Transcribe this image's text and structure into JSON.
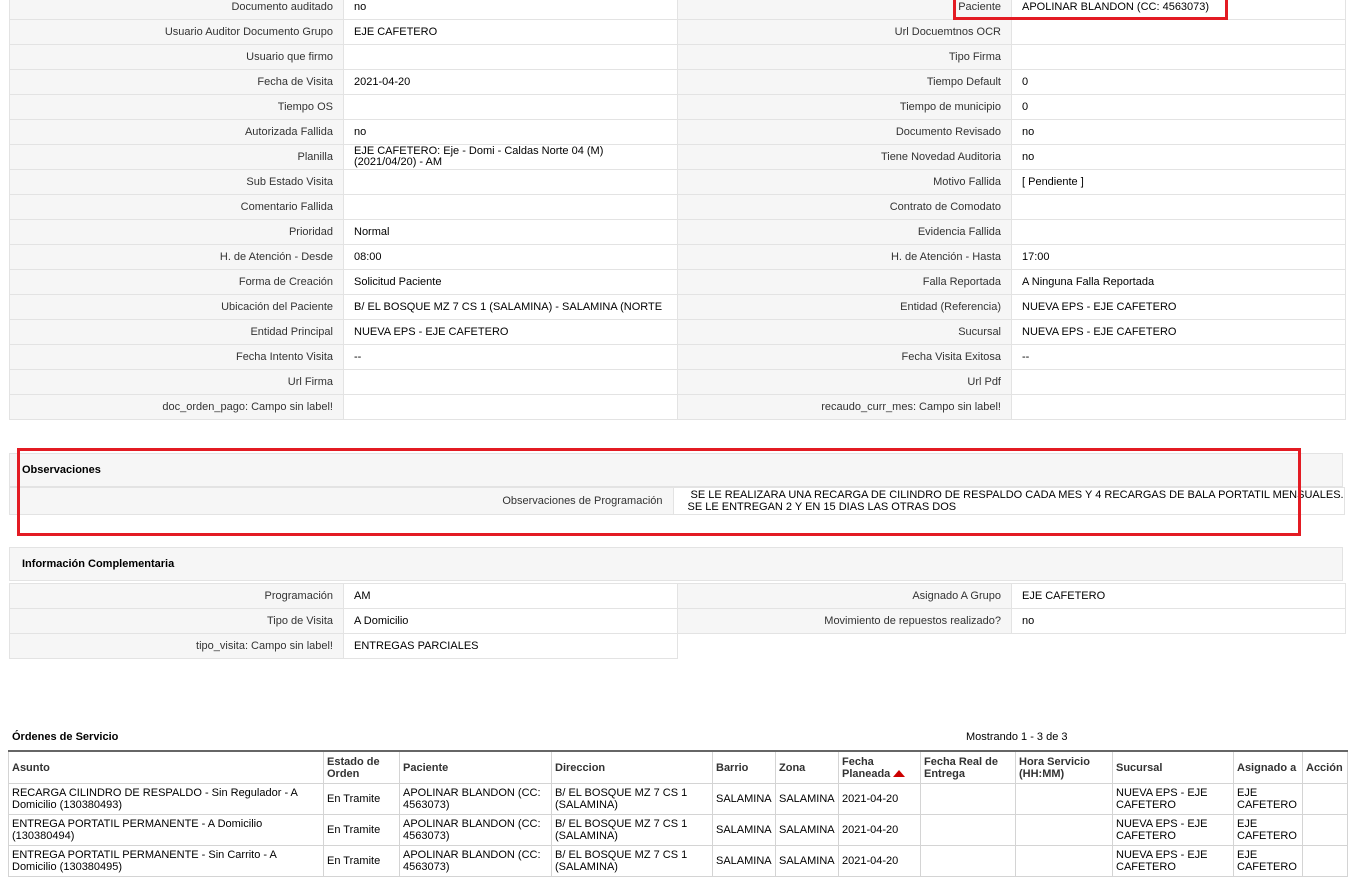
{
  "details": {
    "rows": [
      [
        {
          "label": "Documento auditado",
          "value": "no"
        },
        {
          "label": "Paciente",
          "value": "APOLINAR BLANDON (CC: 4563073)"
        }
      ],
      [
        {
          "label": "Usuario Auditor Documento Grupo",
          "value": "EJE CAFETERO"
        },
        {
          "label": "Url Docuemtnos OCR",
          "value": ""
        }
      ],
      [
        {
          "label": "Usuario que firmo",
          "value": ""
        },
        {
          "label": "Tipo Firma",
          "value": ""
        }
      ],
      [
        {
          "label": "Fecha de Visita",
          "value": "2021-04-20"
        },
        {
          "label": "Tiempo Default",
          "value": "0"
        }
      ],
      [
        {
          "label": "Tiempo OS",
          "value": ""
        },
        {
          "label": "Tiempo de municipio",
          "value": "0"
        }
      ],
      [
        {
          "label": "Autorizada Fallida",
          "value": "no"
        },
        {
          "label": "Documento Revisado",
          "value": "no"
        }
      ],
      [
        {
          "label": "Planilla",
          "value": "EJE CAFETERO: Eje - Domi - Caldas Norte 04 (M) (2021/04/20) - AM"
        },
        {
          "label": "Tiene Novedad Auditoria",
          "value": "no"
        }
      ],
      [
        {
          "label": "Sub Estado Visita",
          "value": ""
        },
        {
          "label": "Motivo Fallida",
          "value": "[ Pendiente ]"
        }
      ],
      [
        {
          "label": "Comentario Fallida",
          "value": ""
        },
        {
          "label": "Contrato de Comodato",
          "value": ""
        }
      ],
      [
        {
          "label": "Prioridad",
          "value": "Normal"
        },
        {
          "label": "Evidencia Fallida",
          "value": ""
        }
      ],
      [
        {
          "label": "H. de Atención - Desde",
          "value": "08:00"
        },
        {
          "label": "H. de Atención - Hasta",
          "value": "17:00"
        }
      ],
      [
        {
          "label": "Forma de Creación",
          "value": "Solicitud Paciente"
        },
        {
          "label": "Falla Reportada",
          "value": "A Ninguna Falla Reportada"
        }
      ],
      [
        {
          "label": "Ubicación del Paciente",
          "value": "B/ EL BOSQUE MZ 7 CS 1 (SALAMINA) - SALAMINA (NORTE"
        },
        {
          "label": "Entidad (Referencia)",
          "value": "NUEVA EPS - EJE CAFETERO"
        }
      ],
      [
        {
          "label": "Entidad Principal",
          "value": "NUEVA EPS - EJE CAFETERO"
        },
        {
          "label": "Sucursal",
          "value": "NUEVA EPS - EJE CAFETERO"
        }
      ],
      [
        {
          "label": "Fecha Intento Visita",
          "value": "--"
        },
        {
          "label": "Fecha Visita Exitosa",
          "value": "--"
        }
      ],
      [
        {
          "label": "Url Firma",
          "value": ""
        },
        {
          "label": "Url Pdf",
          "value": ""
        }
      ],
      [
        {
          "label": "doc_orden_pago: Campo sin label!",
          "value": ""
        },
        {
          "label": "recaudo_curr_mes: Campo sin label!",
          "value": ""
        }
      ]
    ]
  },
  "observaciones": {
    "title": "Observaciones",
    "label": "Observaciones de Programación",
    "line1": "SE LE REALIZARA UNA RECARGA DE CILINDRO DE RESPALDO CADA MES Y 4 RECARGAS DE BALA PORTATIL MENSUALES.",
    "line2": "SE LE ENTREGAN 2 Y EN 15 DIAS LAS OTRAS DOS"
  },
  "complementaria": {
    "title": "Información Complementaria",
    "rows": [
      [
        {
          "label": "Programación",
          "value": "AM"
        },
        {
          "label": "Asignado A Grupo",
          "value": "EJE CAFETERO"
        }
      ],
      [
        {
          "label": "Tipo de Visita",
          "value": "A Domicilio"
        },
        {
          "label": "Movimiento de repuestos realizado?",
          "value": "no"
        }
      ],
      [
        {
          "label": "tipo_visita: Campo sin label!",
          "value": "ENTREGAS PARCIALES"
        }
      ]
    ]
  },
  "orders": {
    "title": "Órdenes de Servicio",
    "count": "Mostrando 1 - 3 de 3",
    "headers": [
      "Asunto",
      "Estado de Orden",
      "Paciente",
      "Direccion",
      "Barrio",
      "Zona",
      "Fecha Planeada",
      "Fecha Real de Entrega",
      "Hora Servicio (HH:MM)",
      "Sucursal",
      "Asignado a",
      "Acción"
    ],
    "rows": [
      [
        "RECARGA CILINDRO DE RESPALDO - Sin Regulador - A Domicilio (130380493)",
        "En Tramite",
        "APOLINAR BLANDON (CC: 4563073)",
        "B/ EL BOSQUE MZ 7 CS 1 (SALAMINA)",
        "SALAMINA",
        "SALAMINA",
        "2021-04-20",
        "",
        "",
        "NUEVA EPS - EJE CAFETERO",
        "EJE CAFETERO",
        ""
      ],
      [
        "ENTREGA PORTATIL PERMANENTE - A Domicilio (130380494)",
        "En Tramite",
        "APOLINAR BLANDON (CC: 4563073)",
        "B/ EL BOSQUE MZ 7 CS 1 (SALAMINA)",
        "SALAMINA",
        "SALAMINA",
        "2021-04-20",
        "",
        "",
        "NUEVA EPS - EJE CAFETERO",
        "EJE CAFETERO",
        ""
      ],
      [
        "ENTREGA PORTATIL PERMANENTE - Sin Carrito - A Domicilio (130380495)",
        "En Tramite",
        "APOLINAR BLANDON (CC: 4563073)",
        "B/ EL BOSQUE MZ 7 CS 1 (SALAMINA)",
        "SALAMINA",
        "SALAMINA",
        "2021-04-20",
        "",
        "",
        "NUEVA EPS - EJE CAFETERO",
        "EJE CAFETERO",
        ""
      ]
    ]
  },
  "colors": {
    "highlight": "#e31b23",
    "sort_arrow": "#cc0000"
  },
  "icons": {
    "sort": "sort-ascending-icon"
  }
}
